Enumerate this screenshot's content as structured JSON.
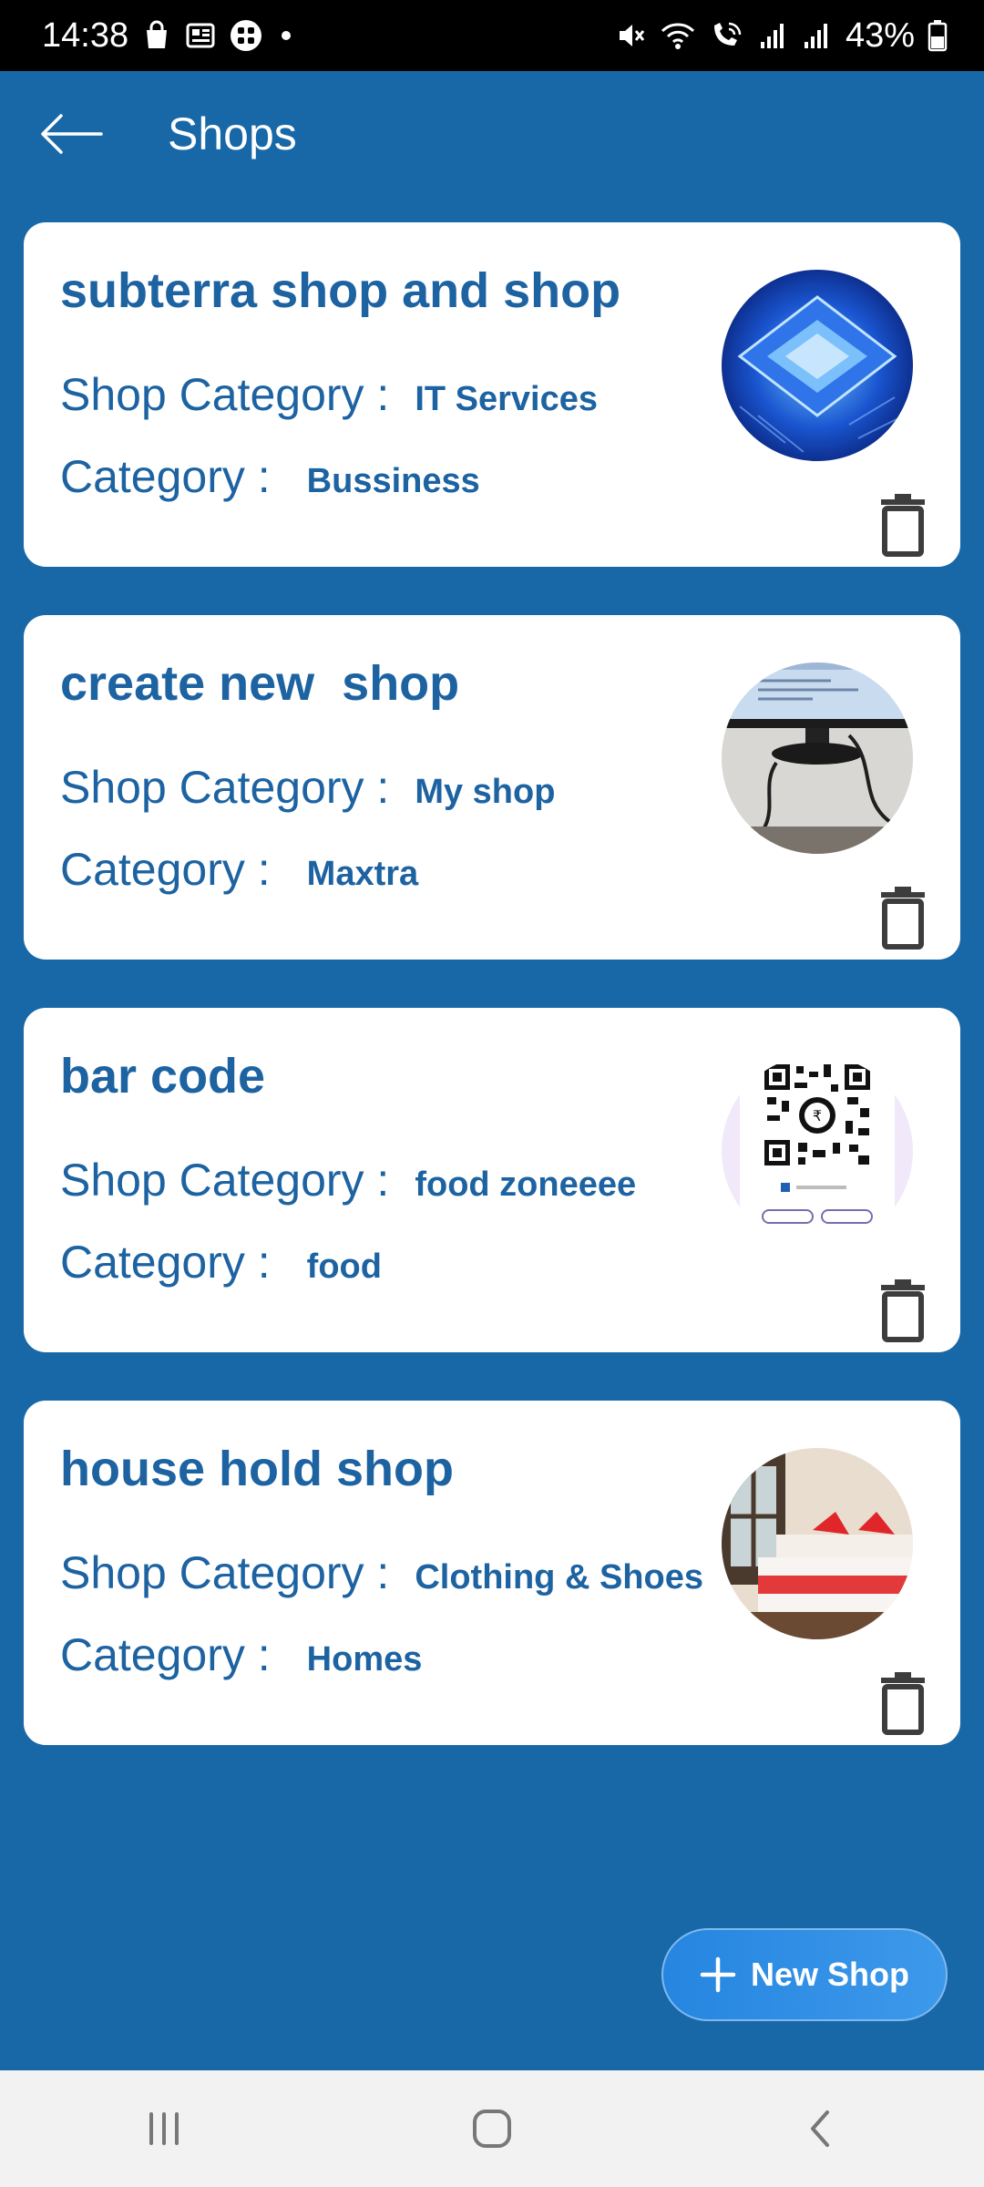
{
  "status_bar": {
    "time": "14:38",
    "battery": "43%",
    "icons": [
      "shopping-bag-icon",
      "news-icon",
      "app-grid-icon",
      "dot-icon",
      "mute-icon",
      "wifi-icon",
      "wifi-calling-icon",
      "signal-icon",
      "signal-icon",
      "battery-icon"
    ]
  },
  "app_bar": {
    "title": "Shops",
    "back_icon": "arrow-left-icon"
  },
  "colors": {
    "background": "#1868a8",
    "card": "#ffffff",
    "text_primary": "#1d63a2",
    "fab": "#2585e0",
    "delete_icon": "#3d3d3d"
  },
  "shops": [
    {
      "name": "subterra shop and shop",
      "shop_category_label": "Shop Category :",
      "shop_category": "IT Services",
      "category_label": "Category :",
      "category": "Bussiness",
      "thumbnail": "processor-chip-image"
    },
    {
      "name": "create new  shop",
      "shop_category_label": "Shop Category :",
      "shop_category": "My shop",
      "category_label": "Category :",
      "category": "Maxtra",
      "thumbnail": "computer-monitor-image"
    },
    {
      "name": "bar code",
      "shop_category_label": "Shop Category :",
      "shop_category": "food zoneeee",
      "category_label": "Category :",
      "category": "food",
      "thumbnail": "qr-code-image"
    },
    {
      "name": "house hold shop",
      "shop_category_label": "Shop Category :",
      "shop_category": "Clothing & Shoes",
      "category_label": "Category :",
      "category": "Homes",
      "thumbnail": "bedroom-image"
    }
  ],
  "fab": {
    "label": "New Shop",
    "icon": "plus-icon"
  },
  "nav_bar": {
    "icons": [
      "recent-apps-icon",
      "home-icon",
      "back-icon"
    ]
  }
}
